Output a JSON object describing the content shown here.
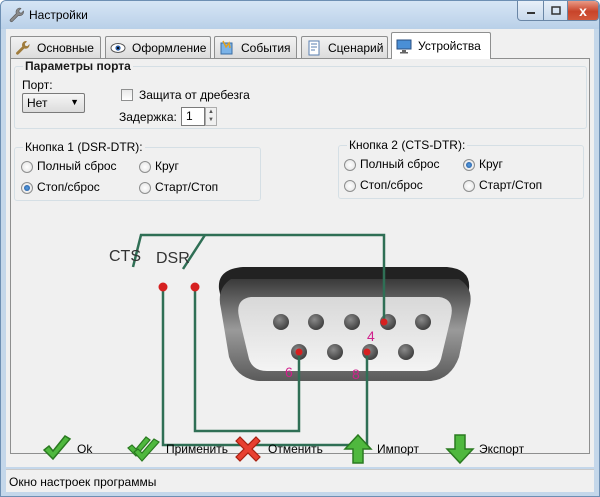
{
  "window": {
    "title": "Настройки",
    "close_glyph": "x"
  },
  "tabs": [
    {
      "label": "Основные",
      "icon": "wrench-icon"
    },
    {
      "label": "Оформление",
      "icon": "eye-icon"
    },
    {
      "label": "События",
      "icon": "event-icon"
    },
    {
      "label": "Сценарий",
      "icon": "script-icon"
    },
    {
      "label": "Устройства",
      "icon": "monitor-icon",
      "active": true
    }
  ],
  "port_params": {
    "title": "Параметры порта",
    "port_label": "Порт:",
    "port_value": "Нет",
    "debounce_label": "Защита от дребезга",
    "debounce_checked": false,
    "delay_label": "Задержка:",
    "delay_value": "1"
  },
  "button1": {
    "title": "Кнопка 1 (DSR-DTR):",
    "options": [
      "Полный сброс",
      "Круг",
      "Стоп/сброс",
      "Старт/Стоп"
    ],
    "selected": "Стоп/сброс"
  },
  "button2": {
    "title": "Кнопка 2 (CTS-DTR):",
    "options": [
      "Полный сброс",
      "Круг",
      "Стоп/сброс",
      "Старт/Стоп"
    ],
    "selected": "Круг"
  },
  "diagram": {
    "switch1_label": "CTS",
    "switch2_label": "DSR",
    "pin_labels": [
      "4",
      "6",
      "8"
    ],
    "wire_color": "#2f6f55",
    "pin_color": "#d62020",
    "pin_label_color": "#d0208c"
  },
  "actions": {
    "ok": "Ok",
    "apply": "Применить",
    "cancel": "Отменить",
    "import": "Импорт",
    "export": "Экспорт"
  },
  "status": "Окно настроек программы"
}
